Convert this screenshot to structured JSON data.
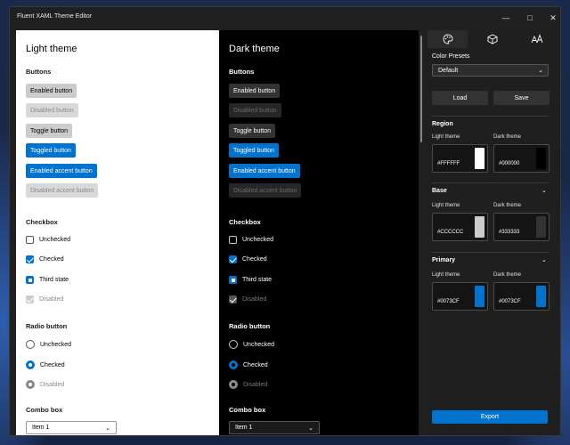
{
  "window": {
    "title": "Fluent XAML Theme Editor",
    "minimize": "—",
    "maximize": "□",
    "close": "✕"
  },
  "light": {
    "title": "Light theme",
    "buttons_header": "Buttons",
    "buttons": [
      "Enabled button",
      "Disabled button",
      "Toggle button",
      "Toggled button",
      "Enabled accent button",
      "Disabled accent button"
    ],
    "checkbox_header": "Checkbox",
    "checkboxes": [
      "Unchecked",
      "Checked",
      "Third state",
      "Disabled"
    ],
    "radio_header": "Radio button",
    "radios": [
      "Unchecked",
      "Checked",
      "Disabled"
    ],
    "combo_header": "Combo box",
    "combo_value": "Item 1"
  },
  "dark": {
    "title": "Dark theme",
    "buttons_header": "Buttons",
    "buttons": [
      "Enabled button",
      "Disabled button",
      "Toggle button",
      "Toggled button",
      "Enabled accent button",
      "Disabled accent button"
    ],
    "checkbox_header": "Checkbox",
    "checkboxes": [
      "Unchecked",
      "Checked",
      "Third state",
      "Disabled"
    ],
    "radio_header": "Radio button",
    "radios": [
      "Unchecked",
      "Checked",
      "Disabled"
    ],
    "combo_header": "Combo box",
    "combo_value": "Item 1"
  },
  "side": {
    "tabs": [
      "palette-icon",
      "cube-icon",
      "font-size-icon"
    ],
    "presets_label": "Color Presets",
    "preset_value": "Default",
    "load": "Load",
    "save": "Save",
    "region": {
      "header": "Region",
      "light_label": "Light theme",
      "dark_label": "Dark theme",
      "light_hex": "#FFFFFF",
      "dark_hex": "#000000"
    },
    "base": {
      "header": "Base",
      "light_label": "Light theme",
      "dark_label": "Dark theme",
      "light_hex": "#CCCCCC",
      "dark_hex": "#333333"
    },
    "primary": {
      "header": "Primary",
      "light_label": "Light theme",
      "dark_label": "Dark theme",
      "light_hex": "#0073CF",
      "dark_hex": "#0073CF"
    },
    "export": "Export"
  },
  "colors": {
    "accent": "#0073CF",
    "region_light": "#FFFFFF",
    "region_dark": "#000000",
    "base_light": "#CCCCCC",
    "base_dark": "#333333"
  }
}
